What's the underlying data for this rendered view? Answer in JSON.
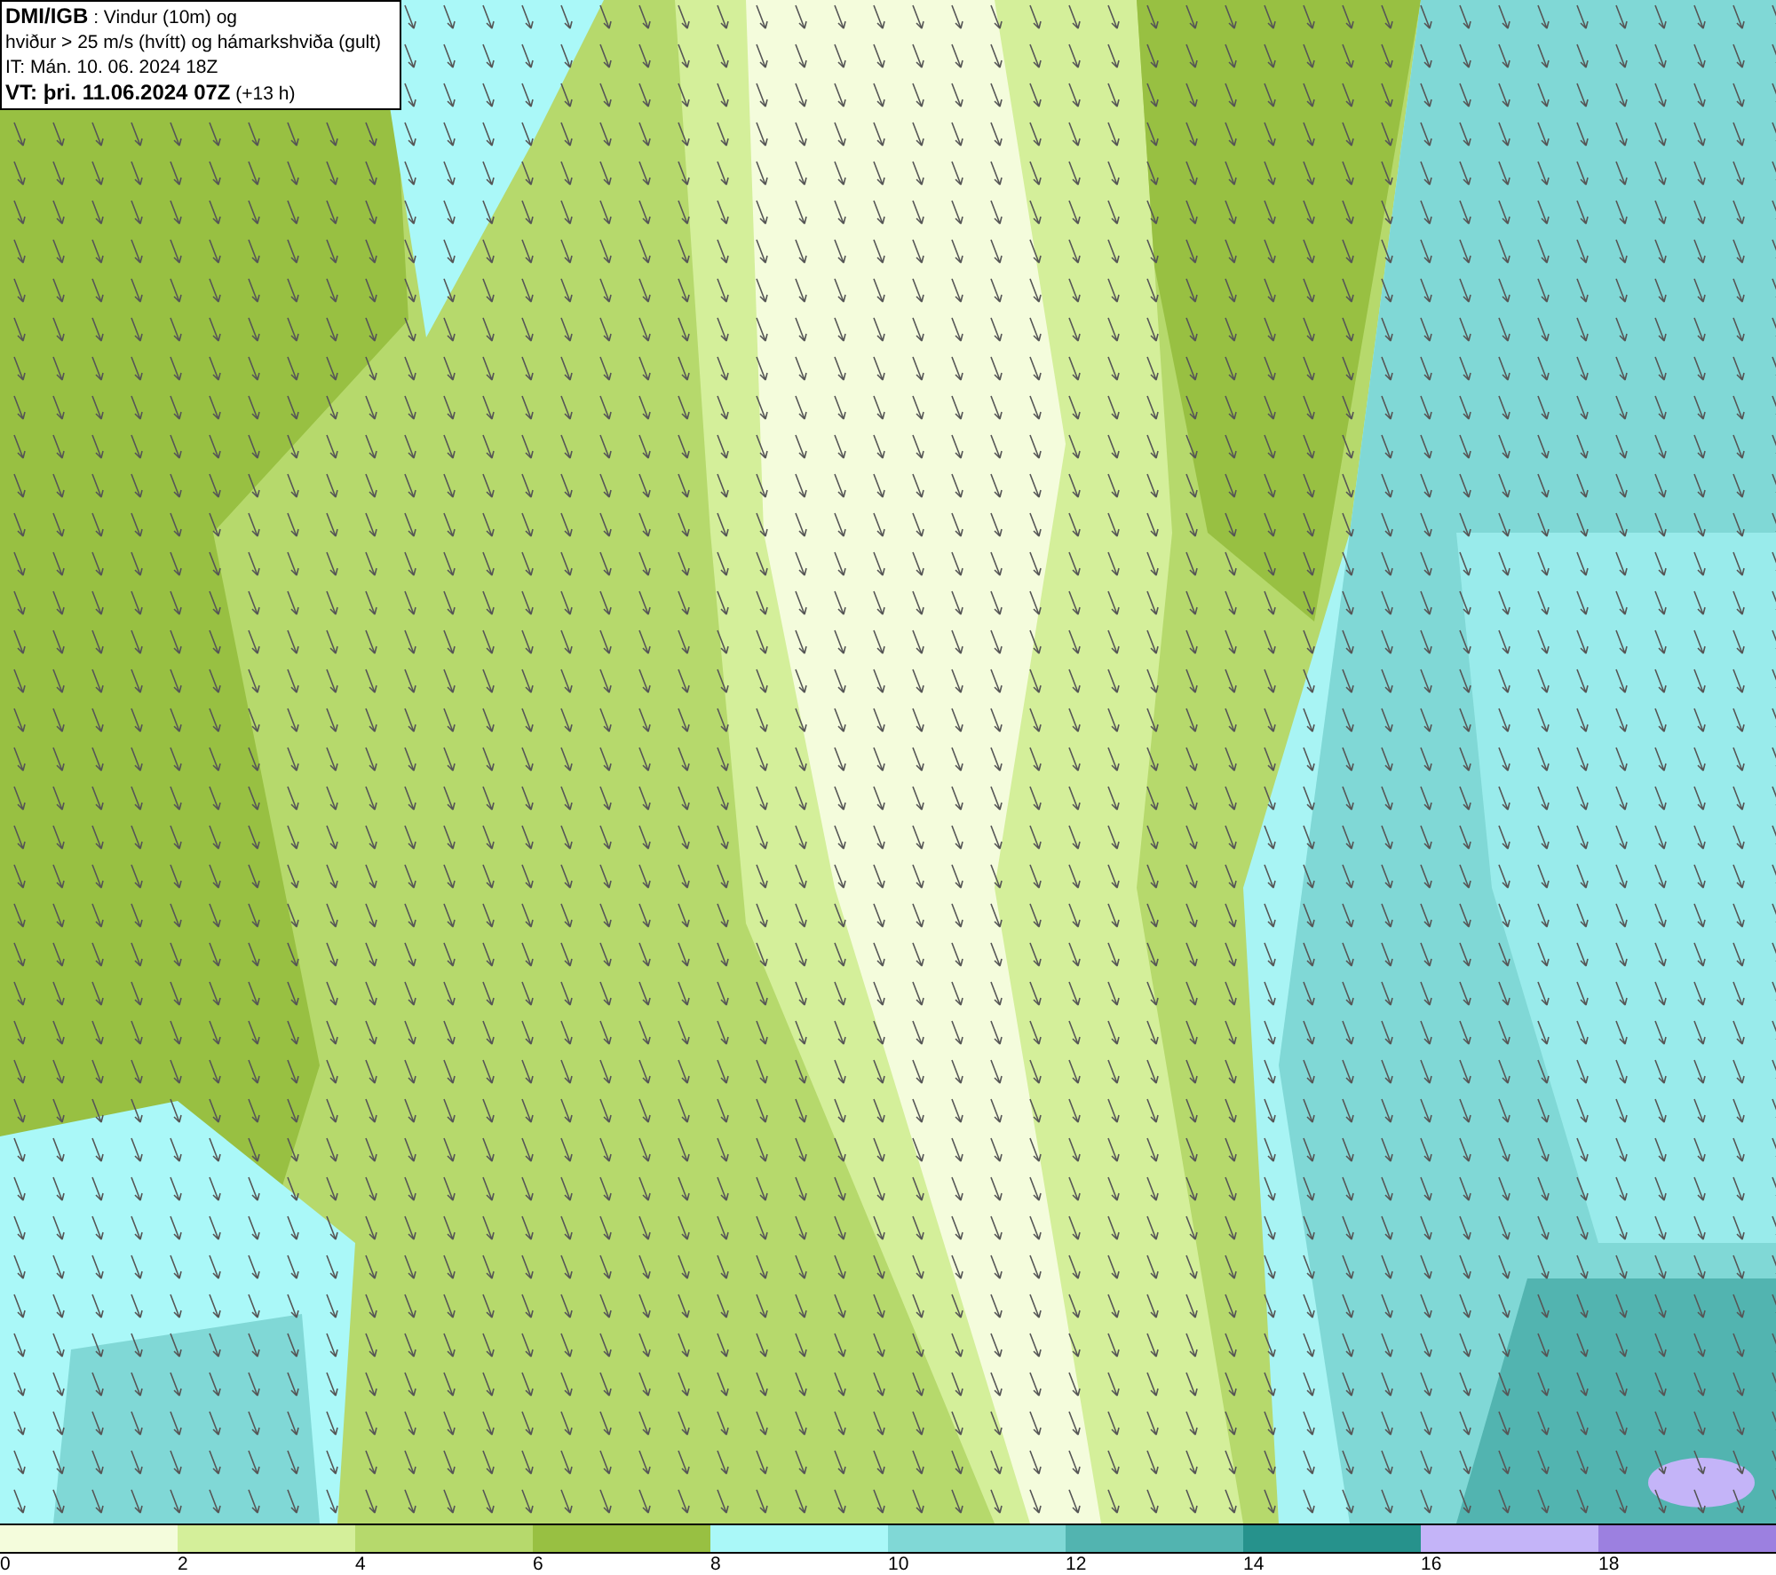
{
  "header": {
    "lines": [
      {
        "text": "**DMI/IGB** : Vindur (10m) og"
      },
      {
        "text": "hviður > 25 m/s (hvítt) og hámarkshviða (gult)"
      },
      {
        "text": "IT: Mán. 10. 06. 2024 18Z"
      },
      {
        "text": "**VT: þri. 11.06.2024 07Z** (+13 h)"
      }
    ]
  },
  "legend": {
    "segments": [
      {
        "color": "#f4fcdc"
      },
      {
        "color": "#d4ef9a"
      },
      {
        "color": "#b6d96c"
      },
      {
        "color": "#98c042"
      },
      {
        "color": "#aaf8f8"
      },
      {
        "color": "#80d8d6"
      },
      {
        "color": "#52b4b0"
      },
      {
        "color": "#26928c"
      },
      {
        "color": "#c4b4f8"
      },
      {
        "color": "#9c80e0"
      }
    ],
    "ticks": [
      "0",
      "2",
      "4",
      "6",
      "8",
      "10",
      "12",
      "14",
      "16",
      "18"
    ]
  }
}
